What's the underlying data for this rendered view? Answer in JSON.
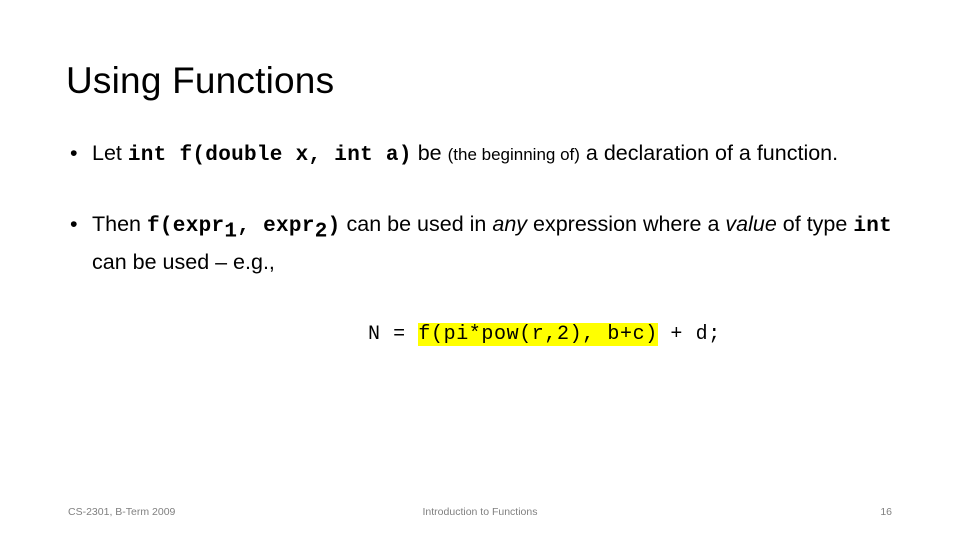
{
  "slide": {
    "title": "Using Functions",
    "page_number": "16",
    "highlight_color": "#FFFF00",
    "footer_color": "#808080"
  },
  "bullets": [
    {
      "marker": "•",
      "parts": {
        "lead": "Let ",
        "code_signature": "int f(double x, int a)",
        "after_code": " be ",
        "parenthetical": "(the beginning of)",
        "tail": " a declaration of a function."
      }
    },
    {
      "marker": "•",
      "parts": {
        "lead": "Then ",
        "code_call_open": "f(expr",
        "sub1": "1",
        "code_call_mid": ", expr",
        "sub2": "2",
        "code_call_close": ")",
        "mid_text": " can be used in ",
        "emphasis_any": "any",
        "after_any": " expression where a ",
        "emphasis_value": "value",
        "after_value": " of type ",
        "code_int": "int",
        "tail": " can be used – e.g.,"
      }
    }
  ],
  "code_example": {
    "prefix": "N = ",
    "highlighted": "f(pi*pow(r,2), b+c)",
    "suffix": " + d;"
  },
  "footer": {
    "left": "CS-2301, B-Term 2009",
    "center": "Introduction to Functions",
    "right": "16"
  }
}
